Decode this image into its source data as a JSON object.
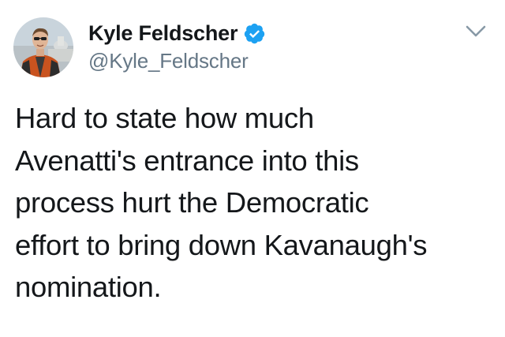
{
  "tweet": {
    "author": {
      "display_name": "Kyle Feldscher",
      "handle": "@Kyle_Feldscher",
      "verified": true,
      "avatar_icon": "profile-photo"
    },
    "text": "Hard to state how much\nAvenatti's entrance into this\nprocess hurt the Democratic\neffort to bring down Kavanaugh's\nnomination.",
    "menu_icon": "chevron-down-icon"
  },
  "colors": {
    "text": "#14171a",
    "secondary": "#657786",
    "verified_blue": "#1da1f2",
    "caret": "#657786"
  }
}
